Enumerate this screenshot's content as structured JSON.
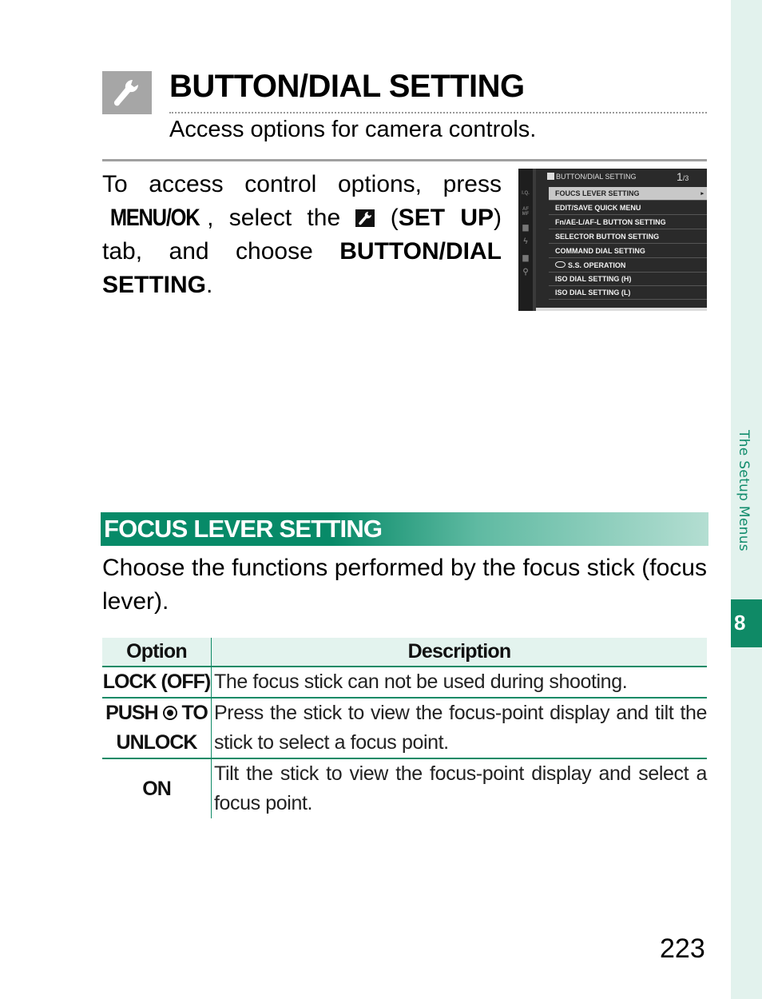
{
  "header": {
    "title": "BUTTON/DIAL SETTING",
    "icon": "wrench-icon",
    "subtitle": "Access options for camera controls."
  },
  "intro": {
    "part1": "To access control options, press ",
    "menu_button": "MENU/OK",
    "part2": ", select the ",
    "tab_icon": "wrench-icon",
    "part3": " (",
    "tab_name": "SET UP",
    "part4": ") tab, and choose ",
    "item_name": "BUTTON/DIAL SETTING",
    "part5": "."
  },
  "camera_screen": {
    "header_title": "BUTTON/DIAL SETTING",
    "page": "1",
    "page_total": "/3",
    "side_tabs": [
      "I.Q.",
      "AF MF",
      "camera",
      "flash",
      "movie",
      "wrench"
    ],
    "items": [
      {
        "label": "FOUCS LEVER SETTING",
        "selected": true,
        "arrow": "▸"
      },
      {
        "label": "EDIT/SAVE QUICK MENU",
        "selected": false
      },
      {
        "label": "Fn/AE-L/AF-L BUTTON SETTING",
        "selected": false
      },
      {
        "label": "SELECTOR BUTTON SETTING",
        "selected": false
      },
      {
        "label": "COMMAND DIAL SETTING",
        "selected": false
      },
      {
        "label": "S.S. OPERATION",
        "selected": false,
        "icon": "dial-icon"
      },
      {
        "label": "ISO DIAL SETTING (H)",
        "selected": false
      },
      {
        "label": "ISO DIAL SETTING (L)",
        "selected": false
      }
    ]
  },
  "section": {
    "title": "FOCUS LEVER SETTING",
    "description": "Choose the functions performed by the focus stick (focus lever)."
  },
  "table": {
    "headers": [
      "Option",
      "Description"
    ],
    "rows": [
      {
        "option": "LOCK (OFF)",
        "description": "The focus stick can not be used during shooting."
      },
      {
        "option_pre": "PUSH",
        "option_icon": "focus-stick-icon",
        "option_post": "TO UNLOCK",
        "description": "Press the stick to view the focus-point display and tilt the stick to select a focus point."
      },
      {
        "option": "ON",
        "description": "Tilt the stick to view the focus-point display and select a focus point."
      }
    ]
  },
  "sidebar": {
    "chapter_label": "The Setup Menus",
    "chapter_number": "8"
  },
  "footer": {
    "page_number": "223"
  },
  "colors": {
    "accent_green": "#0f8a66",
    "sidebar_tint": "#e2f2ed",
    "icon_gray": "#a6a6a6"
  }
}
